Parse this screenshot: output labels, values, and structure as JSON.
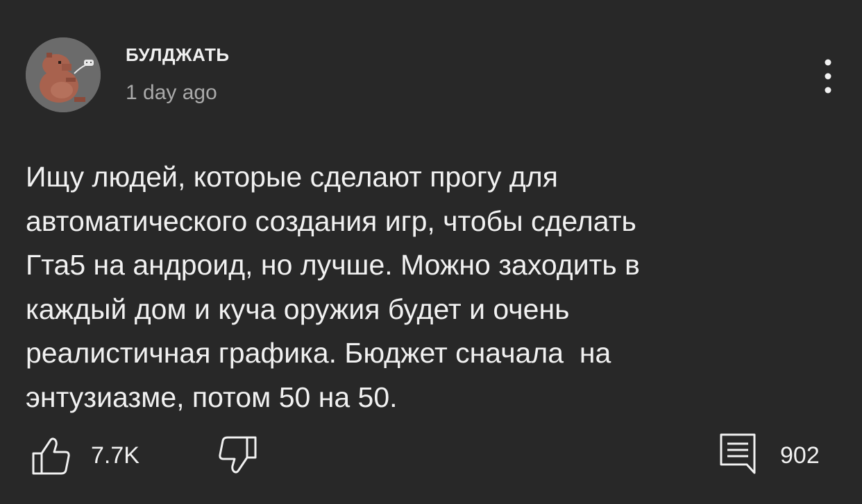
{
  "comment": {
    "author": "БУЛДЖАТЬ",
    "timestamp": "1 day ago",
    "text_lines": [
      "Ищу людей, которые сделают прогу для",
      "автоматического создания игр, чтобы сделать",
      "Гта5 на андроид, но лучше. Можно заходить в",
      "каждый дом и куча оружия будет и очень",
      "реалистичная графика. Бюджет сначала  на",
      "энтузиазме, потом 50 на 50."
    ],
    "like_count": "7.7K",
    "reply_count": "902"
  },
  "icons": {
    "menu": "more-vertical-icon",
    "like": "thumbs-up-icon",
    "dislike": "thumbs-down-icon",
    "reply": "comment-icon"
  },
  "colors": {
    "background": "#282828",
    "text_primary": "#f1f1f1",
    "text_secondary": "#aaaaaa"
  }
}
